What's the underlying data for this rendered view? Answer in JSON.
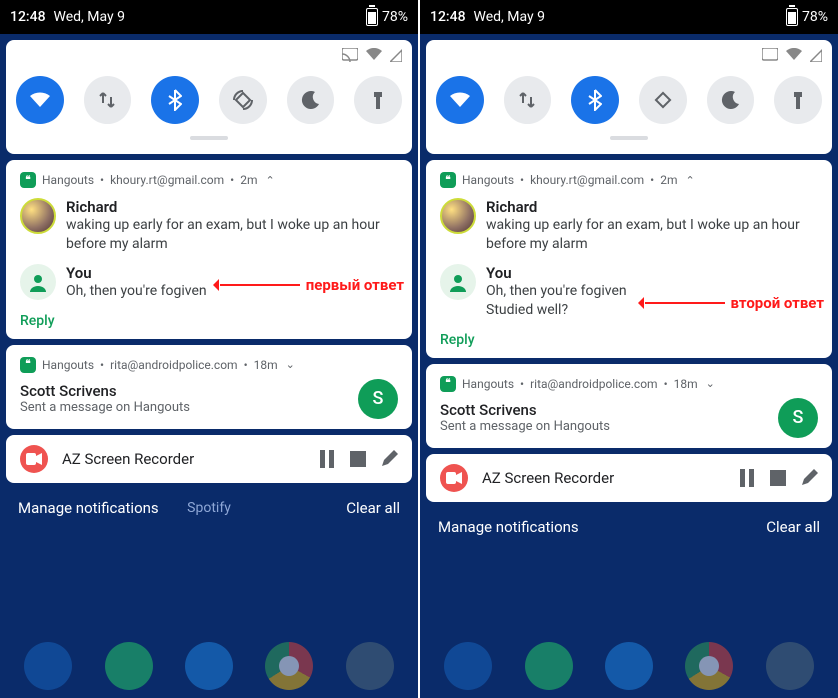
{
  "statusbar": {
    "time": "12:48",
    "date": "Wed, May 9",
    "battery_pct": "78%"
  },
  "quicksettings": {
    "tiles": [
      {
        "name": "wifi",
        "on": true
      },
      {
        "name": "data",
        "on": false
      },
      {
        "name": "bluetooth",
        "on": true
      },
      {
        "name": "rotate",
        "on": false
      },
      {
        "name": "dnd",
        "on": false
      },
      {
        "name": "flashlight",
        "on": false
      }
    ]
  },
  "notif1": {
    "app": "Hangouts",
    "account": "khoury.rt@gmail.com",
    "age": "2m",
    "chat": [
      {
        "who": "Richard",
        "text": "waking up early for an exam, but I woke up an hour before my alarm"
      },
      {
        "who": "You",
        "text": "Oh, then you're fogiven"
      }
    ],
    "chat_extra_line": "Studied well?",
    "reply_label": "Reply"
  },
  "notif2": {
    "app": "Hangouts",
    "account": "rita@androidpolice.com",
    "age": "18m",
    "contact_name": "Scott Scrivens",
    "contact_sub": "Sent a message on Hangouts",
    "contact_initial": "S"
  },
  "az": {
    "title": "AZ Screen Recorder"
  },
  "footer": {
    "manage": "Manage notifications",
    "clear": "Clear all",
    "bg_app": "Spotify"
  },
  "annotations": {
    "first": "первый ответ",
    "second": "второй ответ"
  }
}
